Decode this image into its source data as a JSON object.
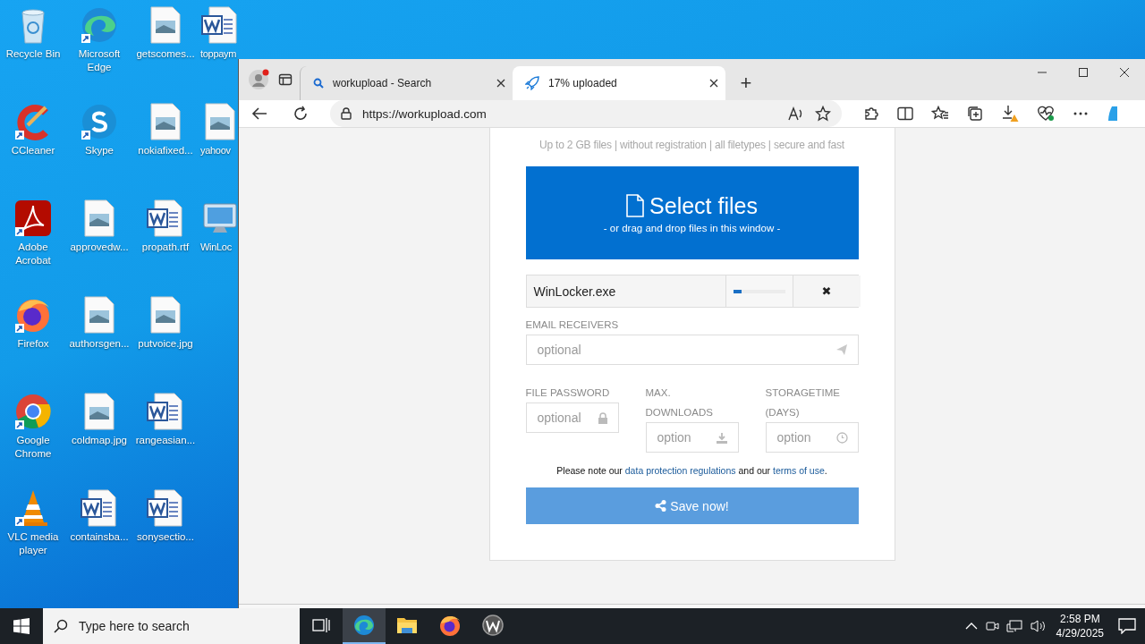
{
  "desktop": {
    "icons": [
      {
        "label": "Recycle Bin",
        "kind": "recycle",
        "shortcut": false
      },
      {
        "label": "CCleaner",
        "kind": "ccleaner",
        "shortcut": true
      },
      {
        "label": "Adobe Acrobat",
        "kind": "acrobat",
        "shortcut": true
      },
      {
        "label": "Firefox",
        "kind": "firefox",
        "shortcut": true
      },
      {
        "label": "Google Chrome",
        "kind": "chrome",
        "shortcut": true
      },
      {
        "label": "VLC media player",
        "kind": "vlc",
        "shortcut": true
      },
      {
        "label": "Microsoft Edge",
        "kind": "edge",
        "shortcut": true
      },
      {
        "label": "Skype",
        "kind": "skype",
        "shortcut": true
      },
      {
        "label": "approvedw...",
        "kind": "image",
        "shortcut": false
      },
      {
        "label": "authorsgen...",
        "kind": "image",
        "shortcut": false
      },
      {
        "label": "coldmap.jpg",
        "kind": "image",
        "shortcut": false
      },
      {
        "label": "containsba...",
        "kind": "word",
        "shortcut": false
      },
      {
        "label": "getscomes...",
        "kind": "image",
        "shortcut": false
      },
      {
        "label": "nokiafixed...",
        "kind": "image",
        "shortcut": false
      },
      {
        "label": "propath.rtf",
        "kind": "word",
        "shortcut": false
      },
      {
        "label": "putvoice.jpg",
        "kind": "image",
        "shortcut": false
      },
      {
        "label": "rangeasian...",
        "kind": "word",
        "shortcut": false
      },
      {
        "label": "sonysectio...",
        "kind": "word",
        "shortcut": false
      },
      {
        "label": "toppaym",
        "kind": "word",
        "shortcut": false
      },
      {
        "label": "yahoov",
        "kind": "image",
        "shortcut": false
      },
      {
        "label": "WinLoc",
        "kind": "monitor",
        "shortcut": false
      }
    ]
  },
  "browser": {
    "tabs": [
      {
        "title": "workupload - Search",
        "selected": false
      },
      {
        "title": "17% uploaded",
        "selected": true
      }
    ],
    "new_tab": "+",
    "url": "https://workupload.com",
    "page": {
      "tagline": "Up to 2 GB files | without registration | all filetypes | secure and fast",
      "select_title": "Select files",
      "select_hint": "- or drag and drop files in this window -",
      "upload": {
        "file_name": "WinLocker.exe",
        "level": 0.17,
        "cancel": "✖"
      },
      "email": {
        "label": "EMAIL RECEIVERS",
        "placeholder": "optional"
      },
      "options": [
        {
          "label": "FILE PASSWORD",
          "placeholder": "optional",
          "kind": "password"
        },
        {
          "label": "MAX. DOWNLOADS",
          "placeholder": "option",
          "kind": "downloads"
        },
        {
          "label": "STORAGETIME (DAYS)",
          "placeholder": "option",
          "kind": "time"
        }
      ],
      "note": {
        "lead": "Please note our ",
        "privacy_link": "data protection regulations",
        "middle": " and our ",
        "terms_link": "terms of use",
        "end": "."
      },
      "save_button": "Save now!"
    }
  },
  "taskbar": {
    "search_placeholder": "Type here to search",
    "apps": [
      {
        "kind": "edge",
        "active": true
      },
      {
        "kind": "explorer",
        "active": false
      },
      {
        "kind": "firefox",
        "active": false
      },
      {
        "kind": "wordpad",
        "active": false
      }
    ],
    "time": "2:58 PM",
    "date": "4/29/2025"
  }
}
